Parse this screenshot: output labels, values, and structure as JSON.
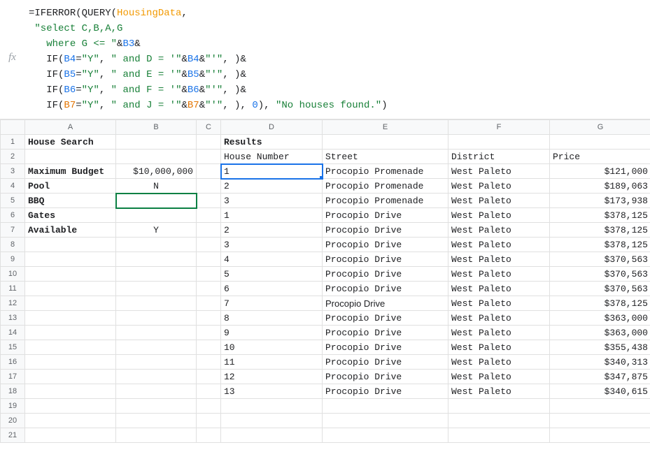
{
  "formula": {
    "line1_a": "=",
    "line1_fn1": "IFERROR",
    "line1_p1": "(",
    "line1_fn2": "QUERY",
    "line1_p2": "(",
    "line1_name": "HousingData",
    "line1_comma": ",",
    "line2_str": "\"select C,B,A,G",
    "line3_a": "  where G <= \"",
    "line3_amp": "&",
    "line3_ref": "B3",
    "line3_amp2": "&",
    "line4_if": "  IF",
    "line4_p": "(",
    "line4_ref": "B4",
    "line4_eq": "=",
    "line4_y": "\"Y\"",
    "line4_str": "\" and D = '\"",
    "line4_amp": "&",
    "line4_ref2": "B4",
    "line4_amp2": "&",
    "line4_q": "\"'\"",
    "line4_end": ", )&",
    "line5_if": "  IF",
    "line5_p": "(",
    "line5_ref": "B5",
    "line5_eq": "=",
    "line5_y": "\"Y\"",
    "line5_str": "\" and E = '\"",
    "line5_amp": "&",
    "line5_ref2": "B5",
    "line5_amp2": "&",
    "line5_q": "\"'\"",
    "line5_end": ", )&",
    "line6_if": "  IF",
    "line6_p": "(",
    "line6_ref": "B6",
    "line6_eq": "=",
    "line6_y": "\"Y\"",
    "line6_str": "\" and F = '\"",
    "line6_amp": "&",
    "line6_ref2": "B6",
    "line6_amp2": "&",
    "line6_q": "\"'\"",
    "line6_end": ", )&",
    "line7_if": "  IF",
    "line7_p": "(",
    "line7_ref": "B7",
    "line7_eq": "=",
    "line7_y": "\"Y\"",
    "line7_str": "\" and J = '\"",
    "line7_amp": "&",
    "line7_ref2": "B7",
    "line7_amp2": "&",
    "line7_q": "\"'\"",
    "line7_mid": ", ), ",
    "line7_zero": "0",
    "line7_close": "), ",
    "line7_err": "\"No houses found.\"",
    "line7_end": ")"
  },
  "fx_label": "fx",
  "col_headers": [
    "A",
    "B",
    "C",
    "D",
    "E",
    "F",
    "G"
  ],
  "labels": {
    "house_search": "House Search",
    "results": "Results",
    "house_number": "House Number",
    "street": "Street",
    "district": "District",
    "price": "Price",
    "max_budget": "Maximum Budget",
    "pool": "Pool",
    "bbq": "BBQ",
    "gates": "Gates",
    "available": "Available"
  },
  "inputs": {
    "budget": "$10,000,000",
    "pool": "N",
    "bbq": "",
    "gates": "",
    "available": "Y"
  },
  "rows": [
    {
      "r": "1"
    },
    {
      "r": "2"
    },
    {
      "r": "3"
    },
    {
      "r": "4"
    },
    {
      "r": "5"
    },
    {
      "r": "6"
    },
    {
      "r": "7"
    },
    {
      "r": "8"
    },
    {
      "r": "9"
    },
    {
      "r": "10"
    },
    {
      "r": "11"
    },
    {
      "r": "12"
    },
    {
      "r": "13"
    },
    {
      "r": "14"
    },
    {
      "r": "15"
    },
    {
      "r": "16"
    },
    {
      "r": "17"
    },
    {
      "r": "18"
    },
    {
      "r": "19"
    },
    {
      "r": "20"
    },
    {
      "r": "21"
    }
  ],
  "results": [
    {
      "num": "1",
      "street": "Procopio Promenade",
      "district": "West Paleto",
      "price": "$121,000",
      "font": "mono"
    },
    {
      "num": "2",
      "street": "Procopio Promenade",
      "district": "West Paleto",
      "price": "$189,063",
      "font": "mono"
    },
    {
      "num": "3",
      "street": "Procopio Promenade",
      "district": "West Paleto",
      "price": "$173,938",
      "font": "mono"
    },
    {
      "num": "1",
      "street": "Procopio Drive",
      "district": "West Paleto",
      "price": "$378,125",
      "font": "mono"
    },
    {
      "num": "2",
      "street": "Procopio Drive",
      "district": "West Paleto",
      "price": "$378,125",
      "font": "mono"
    },
    {
      "num": "3",
      "street": "Procopio Drive",
      "district": "West Paleto",
      "price": "$378,125",
      "font": "mono"
    },
    {
      "num": "4",
      "street": "Procopio Drive",
      "district": "West Paleto",
      "price": "$370,563",
      "font": "mono"
    },
    {
      "num": "5",
      "street": "Procopio Drive",
      "district": "West Paleto",
      "price": "$370,563",
      "font": "mono"
    },
    {
      "num": "6",
      "street": "Procopio Drive",
      "district": "West Paleto",
      "price": "$370,563",
      "font": "mono"
    },
    {
      "num": "7",
      "street": "Procopio Drive",
      "district": "West Paleto",
      "price": "$378,125",
      "font": "arial"
    },
    {
      "num": "8",
      "street": "Procopio Drive",
      "district": "West Paleto",
      "price": "$363,000",
      "font": "mono"
    },
    {
      "num": "9",
      "street": "Procopio Drive",
      "district": "West Paleto",
      "price": "$363,000",
      "font": "mono"
    },
    {
      "num": "10",
      "street": "Procopio Drive",
      "district": "West Paleto",
      "price": "$355,438",
      "font": "mono"
    },
    {
      "num": "11",
      "street": "Procopio Drive",
      "district": "West Paleto",
      "price": "$340,313",
      "font": "mono"
    },
    {
      "num": "12",
      "street": "Procopio Drive",
      "district": "West Paleto",
      "price": "$347,875",
      "font": "mono"
    },
    {
      "num": "13",
      "street": "Procopio Drive",
      "district": "West Paleto",
      "price": "$340,615",
      "font": "mono"
    }
  ]
}
